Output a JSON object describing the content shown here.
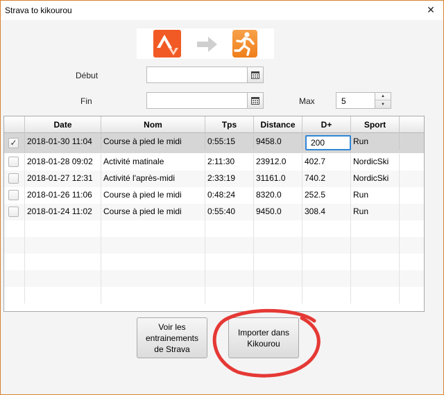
{
  "window": {
    "title": "Strava to kikourou",
    "close_glyph": "✕"
  },
  "filters": {
    "debut_label": "Début",
    "debut_value": "",
    "fin_label": "Fin",
    "fin_value": "",
    "max_label": "Max",
    "max_value": "5"
  },
  "table": {
    "columns": [
      "",
      "Date",
      "Nom",
      "Tps",
      "Distance",
      "D+",
      "Sport"
    ],
    "rows": [
      {
        "checked": true,
        "date": "2018-01-30 11:04",
        "nom": "Course à pied le midi",
        "tps": "0:55:15",
        "distance": "9458.0",
        "dplus": "200",
        "sport": "Run"
      },
      {
        "checked": false,
        "date": "2018-01-28 09:02",
        "nom": "Activité matinale",
        "tps": "2:11:30",
        "distance": "23912.0",
        "dplus": "402.7",
        "sport": "NordicSki"
      },
      {
        "checked": false,
        "date": "2018-01-27 12:31",
        "nom": "Activité l'après-midi",
        "tps": "2:33:19",
        "distance": "31161.0",
        "dplus": "740.2",
        "sport": "NordicSki"
      },
      {
        "checked": false,
        "date": "2018-01-26 11:06",
        "nom": "Course à pied le midi",
        "tps": "0:48:24",
        "distance": "8320.0",
        "dplus": "252.5",
        "sport": "Run"
      },
      {
        "checked": false,
        "date": "2018-01-24 11:02",
        "nom": "Course à pied le midi",
        "tps": "0:55:40",
        "distance": "9450.0",
        "dplus": "308.4",
        "sport": "Run"
      }
    ]
  },
  "buttons": {
    "voir_line1": "Voir les",
    "voir_line2": "entrainements",
    "voir_line3": "de Strava",
    "importer_line1": "Importer dans",
    "importer_line2": "Kikourou"
  },
  "icons": {
    "strava": "strava-logo-icon",
    "arrow": "arrow-right-icon",
    "kikourou": "kikourou-runner-icon",
    "calendar": "calendar-icon",
    "check": "✓"
  },
  "colors": {
    "strava_orange": "#f15a24",
    "kikourou_orange": "#ef7f1a",
    "annotation_red": "#e53935",
    "edit_focus": "#2f86d6",
    "selected_row": "#d6d6d6"
  }
}
